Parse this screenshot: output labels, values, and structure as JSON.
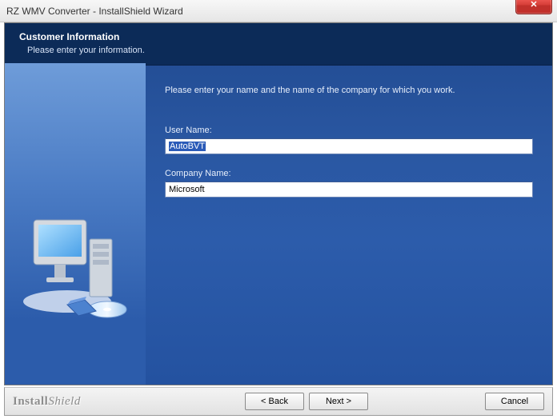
{
  "window": {
    "title": "RZ WMV Converter - InstallShield Wizard"
  },
  "header": {
    "title": "Customer Information",
    "subtitle": "Please enter your information."
  },
  "main": {
    "instruction": "Please enter your name and the name of the company for which you work.",
    "username_label": "User Name:",
    "username_value": "AutoBVT",
    "company_label": "Company Name:",
    "company_value": "Microsoft"
  },
  "footer": {
    "brand_1": "Install",
    "brand_2": "Shield",
    "back": "< Back",
    "next": "Next >",
    "cancel": "Cancel"
  }
}
